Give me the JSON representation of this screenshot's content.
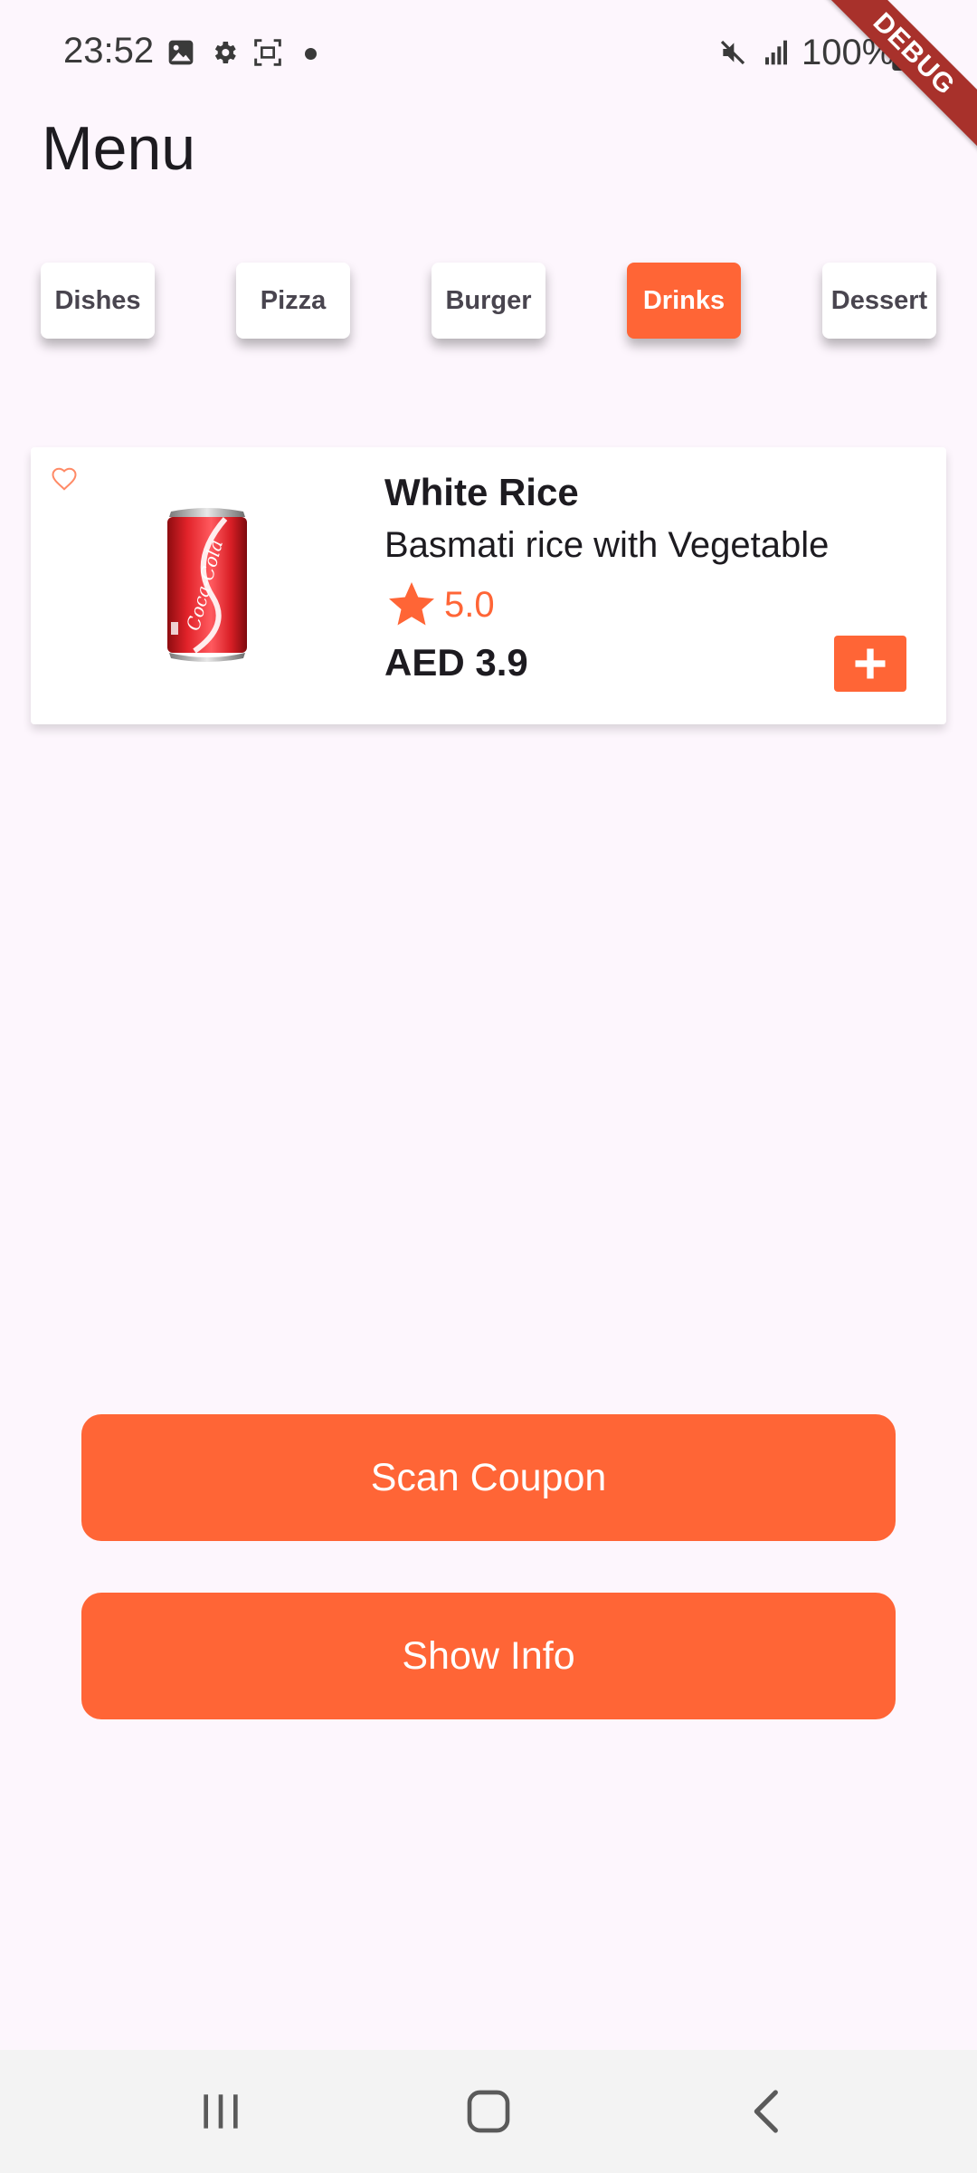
{
  "status_bar": {
    "time": "23:52",
    "battery": "100%",
    "icons": [
      "gallery-icon",
      "settings-icon",
      "screenshot-icon",
      "notification-dot",
      "mute-icon",
      "signal-icon",
      "battery-charging-icon"
    ]
  },
  "debug_banner": "DEBUG",
  "header": {
    "title": "Menu"
  },
  "categories": {
    "items": [
      {
        "label": "Dishes",
        "active": false
      },
      {
        "label": "Pizza",
        "active": false
      },
      {
        "label": "Burger",
        "active": false
      },
      {
        "label": "Drinks",
        "active": true
      },
      {
        "label": "Dessert",
        "active": false
      }
    ]
  },
  "product": {
    "name": "White Rice",
    "description": "Basmati rice with Vegetable",
    "rating": "5.0",
    "price": "AED 3.9",
    "image_label": "Coca-Cola",
    "favorite": false
  },
  "actions": {
    "scan_coupon": "Scan Coupon",
    "show_info": "Show Info"
  },
  "navigation": {
    "icons": [
      "recent-apps-icon",
      "home-icon",
      "back-icon"
    ]
  },
  "colors": {
    "accent": "#ff6536",
    "background": "#fdf6fd",
    "card": "#ffffff",
    "debug": "#a8312b"
  }
}
